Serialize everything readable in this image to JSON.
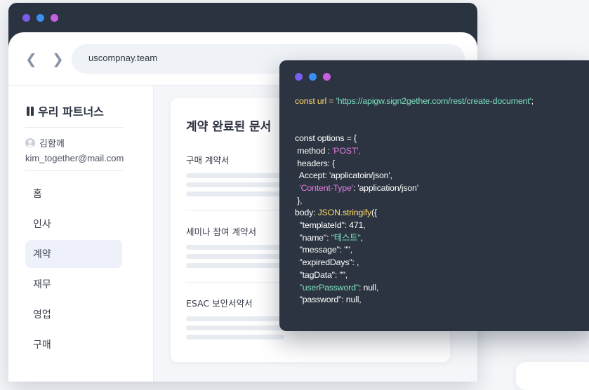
{
  "browser": {
    "dot_colors": [
      "#7b5cf0",
      "#3b8ef2",
      "#c85ee0"
    ],
    "url": "uscompnay.team",
    "back_icon": "chevron-left-icon",
    "forward_icon": "chevron-right-icon"
  },
  "sidebar": {
    "brand": "우리 파트너스",
    "brand_icon": "book-icon",
    "user_name": "김함께",
    "user_email": "kim_together@mail.com",
    "items": [
      {
        "label": "홈",
        "active": false
      },
      {
        "label": "인사",
        "active": false
      },
      {
        "label": "계약",
        "active": true
      },
      {
        "label": "재무",
        "active": false
      },
      {
        "label": "영업",
        "active": false
      },
      {
        "label": "구매",
        "active": false
      }
    ]
  },
  "main": {
    "card_title": "계약 완료된 문서",
    "documents": [
      {
        "name": "구매 계약서"
      },
      {
        "name": "세미나 참여 계약서"
      },
      {
        "name": "ESAC 보안서약서"
      }
    ]
  },
  "code_window": {
    "dot_colors": [
      "#7b5cf0",
      "#3b8ef2",
      "#c85ee0"
    ],
    "colors": {
      "string_yellow": "#ffd76a",
      "string_green": "#7ee0c2",
      "key_pink": "#e57fe0"
    },
    "line_url_a": "const url = ",
    "line_url_b": "'https://apigw.sign2gether.com/rest/create-document'",
    "line_url_c": ";",
    "line_options": "const options = {",
    "line_method_a": " method : ",
    "line_method_b": "'POST',",
    "line_headers": " headers: {",
    "line_accept": "  Accept: 'applicatoin/json',",
    "line_ct_a": "  ",
    "line_ct_b": "'Content-Type'",
    "line_ct_c": ": 'application/json'",
    "line_close": " },",
    "line_body_a": "body: ",
    "line_body_b": "JSON.stringify",
    "line_body_c": "({",
    "line_template": "  \"templateId\": 471,",
    "line_name_a": "  \"name\": ",
    "line_name_b": "\"테스트\"",
    "line_name_c": ",",
    "line_message": "  \"message\": \"\",",
    "line_expired": "  \"expiredDays\": ,",
    "line_tag": "  \"tagData\": \"\",",
    "line_userpw_a": "  ",
    "line_userpw_b": "\"userPassword\"",
    "line_userpw_c": ": null,",
    "line_password": "  \"password\": null,"
  }
}
